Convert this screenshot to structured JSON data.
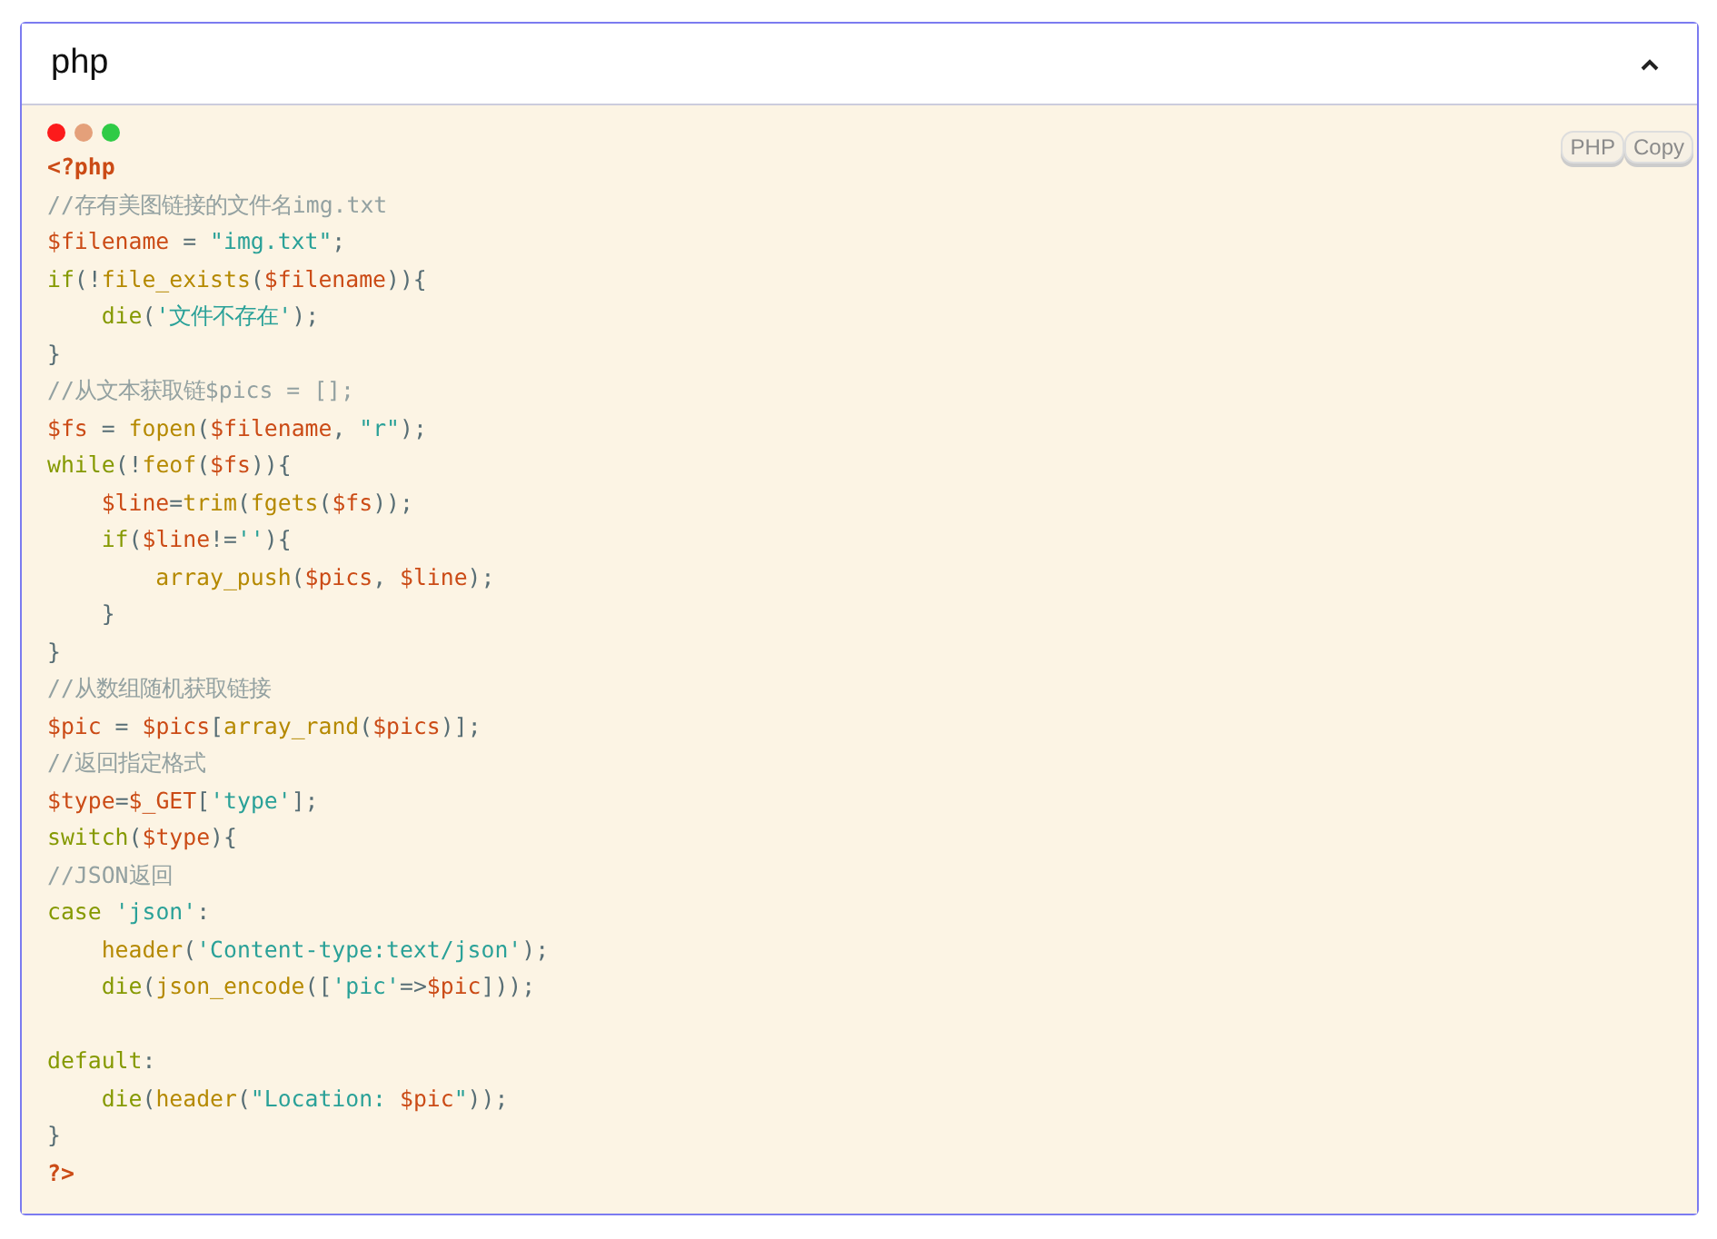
{
  "panel": {
    "title": "php",
    "expanded": true
  },
  "code_block": {
    "buttons": [
      {
        "label": "PHP"
      },
      {
        "label": "Copy"
      }
    ],
    "lines": [
      {
        "kind": "code",
        "tokens": [
          {
            "kind": "tag",
            "text": "<?php"
          }
        ]
      },
      {
        "kind": "code",
        "tokens": [
          {
            "kind": "comment",
            "text": "//存有美图链接的文件名img.txt"
          }
        ]
      },
      {
        "kind": "code",
        "tokens": [
          {
            "kind": "var",
            "text": "$filename"
          },
          {
            "kind": "punct",
            "text": " = "
          },
          {
            "kind": "str",
            "text": "\"img.txt\""
          },
          {
            "kind": "punct",
            "text": ";"
          }
        ]
      },
      {
        "kind": "code",
        "tokens": [
          {
            "kind": "kw",
            "text": "if"
          },
          {
            "kind": "punct",
            "text": "(!"
          },
          {
            "kind": "fn",
            "text": "file_exists"
          },
          {
            "kind": "punct",
            "text": "("
          },
          {
            "kind": "var",
            "text": "$filename"
          },
          {
            "kind": "punct",
            "text": ")){"
          }
        ]
      },
      {
        "kind": "code",
        "tokens": [
          {
            "kind": "kw",
            "text": "    die"
          },
          {
            "kind": "punct",
            "text": "("
          },
          {
            "kind": "str",
            "text": "'文件不存在'"
          },
          {
            "kind": "punct",
            "text": ");"
          }
        ]
      },
      {
        "kind": "code",
        "tokens": [
          {
            "kind": "punct",
            "text": "}"
          }
        ]
      },
      {
        "kind": "code",
        "tokens": [
          {
            "kind": "comment",
            "text": "//从文本获取链$pics = [];"
          }
        ]
      },
      {
        "kind": "code",
        "tokens": [
          {
            "kind": "var",
            "text": "$fs"
          },
          {
            "kind": "punct",
            "text": " = "
          },
          {
            "kind": "fn",
            "text": "fopen"
          },
          {
            "kind": "punct",
            "text": "("
          },
          {
            "kind": "var",
            "text": "$filename"
          },
          {
            "kind": "punct",
            "text": ", "
          },
          {
            "kind": "str",
            "text": "\"r\""
          },
          {
            "kind": "punct",
            "text": ");"
          }
        ]
      },
      {
        "kind": "code",
        "tokens": [
          {
            "kind": "kw",
            "text": "while"
          },
          {
            "kind": "punct",
            "text": "(!"
          },
          {
            "kind": "fn",
            "text": "feof"
          },
          {
            "kind": "punct",
            "text": "("
          },
          {
            "kind": "var",
            "text": "$fs"
          },
          {
            "kind": "punct",
            "text": ")){"
          }
        ]
      },
      {
        "kind": "code",
        "tokens": [
          {
            "kind": "var",
            "text": "    $line"
          },
          {
            "kind": "punct",
            "text": "="
          },
          {
            "kind": "fn",
            "text": "trim"
          },
          {
            "kind": "punct",
            "text": "("
          },
          {
            "kind": "fn",
            "text": "fgets"
          },
          {
            "kind": "punct",
            "text": "("
          },
          {
            "kind": "var",
            "text": "$fs"
          },
          {
            "kind": "punct",
            "text": "));"
          }
        ]
      },
      {
        "kind": "code",
        "tokens": [
          {
            "kind": "kw",
            "text": "    if"
          },
          {
            "kind": "punct",
            "text": "("
          },
          {
            "kind": "var",
            "text": "$line"
          },
          {
            "kind": "punct",
            "text": "!="
          },
          {
            "kind": "str",
            "text": "''"
          },
          {
            "kind": "punct",
            "text": "){"
          }
        ]
      },
      {
        "kind": "code",
        "tokens": [
          {
            "kind": "fn",
            "text": "        array_push"
          },
          {
            "kind": "punct",
            "text": "("
          },
          {
            "kind": "var",
            "text": "$pics"
          },
          {
            "kind": "punct",
            "text": ", "
          },
          {
            "kind": "var",
            "text": "$line"
          },
          {
            "kind": "punct",
            "text": ");"
          }
        ]
      },
      {
        "kind": "code",
        "tokens": [
          {
            "kind": "punct",
            "text": "    }"
          }
        ]
      },
      {
        "kind": "code",
        "tokens": [
          {
            "kind": "punct",
            "text": "}"
          }
        ]
      },
      {
        "kind": "code",
        "tokens": [
          {
            "kind": "comment",
            "text": "//从数组随机获取链接"
          }
        ]
      },
      {
        "kind": "code",
        "tokens": [
          {
            "kind": "var",
            "text": "$pic"
          },
          {
            "kind": "punct",
            "text": " = "
          },
          {
            "kind": "var",
            "text": "$pics"
          },
          {
            "kind": "punct",
            "text": "["
          },
          {
            "kind": "fn",
            "text": "array_rand"
          },
          {
            "kind": "punct",
            "text": "("
          },
          {
            "kind": "var",
            "text": "$pics"
          },
          {
            "kind": "punct",
            "text": ")];"
          }
        ]
      },
      {
        "kind": "code",
        "tokens": [
          {
            "kind": "comment",
            "text": "//返回指定格式"
          }
        ]
      },
      {
        "kind": "code",
        "tokens": [
          {
            "kind": "var",
            "text": "$type"
          },
          {
            "kind": "punct",
            "text": "="
          },
          {
            "kind": "var",
            "text": "$_GET"
          },
          {
            "kind": "punct",
            "text": "["
          },
          {
            "kind": "str",
            "text": "'type'"
          },
          {
            "kind": "punct",
            "text": "];"
          }
        ]
      },
      {
        "kind": "code",
        "tokens": [
          {
            "kind": "kw",
            "text": "switch"
          },
          {
            "kind": "punct",
            "text": "("
          },
          {
            "kind": "var",
            "text": "$type"
          },
          {
            "kind": "punct",
            "text": "){"
          }
        ]
      },
      {
        "kind": "code",
        "tokens": [
          {
            "kind": "comment",
            "text": "//JSON返回"
          }
        ]
      },
      {
        "kind": "code",
        "tokens": [
          {
            "kind": "kw",
            "text": "case "
          },
          {
            "kind": "str",
            "text": "'json'"
          },
          {
            "kind": "punct",
            "text": ":"
          }
        ]
      },
      {
        "kind": "code",
        "tokens": [
          {
            "kind": "fn",
            "text": "    header"
          },
          {
            "kind": "punct",
            "text": "("
          },
          {
            "kind": "str",
            "text": "'Content-type:text/json'"
          },
          {
            "kind": "punct",
            "text": ");"
          }
        ]
      },
      {
        "kind": "code",
        "tokens": [
          {
            "kind": "kw",
            "text": "    die"
          },
          {
            "kind": "punct",
            "text": "("
          },
          {
            "kind": "fn",
            "text": "json_encode"
          },
          {
            "kind": "punct",
            "text": "(["
          },
          {
            "kind": "str",
            "text": "'pic'"
          },
          {
            "kind": "punct",
            "text": "=>"
          },
          {
            "kind": "var",
            "text": "$pic"
          },
          {
            "kind": "punct",
            "text": "]));"
          }
        ]
      },
      {
        "kind": "blank"
      },
      {
        "kind": "code",
        "tokens": [
          {
            "kind": "kw",
            "text": "default"
          },
          {
            "kind": "punct",
            "text": ":"
          }
        ]
      },
      {
        "kind": "code",
        "tokens": [
          {
            "kind": "kw",
            "text": "    die"
          },
          {
            "kind": "punct",
            "text": "("
          },
          {
            "kind": "fn",
            "text": "header"
          },
          {
            "kind": "punct",
            "text": "("
          },
          {
            "kind": "str",
            "text": "\"Location: "
          },
          {
            "kind": "var",
            "text": "$pic"
          },
          {
            "kind": "str",
            "text": "\""
          },
          {
            "kind": "punct",
            "text": "));"
          }
        ]
      },
      {
        "kind": "code",
        "tokens": [
          {
            "kind": "punct",
            "text": "}"
          }
        ]
      },
      {
        "kind": "code",
        "tokens": [
          {
            "kind": "tag",
            "text": "?>"
          }
        ]
      }
    ]
  }
}
